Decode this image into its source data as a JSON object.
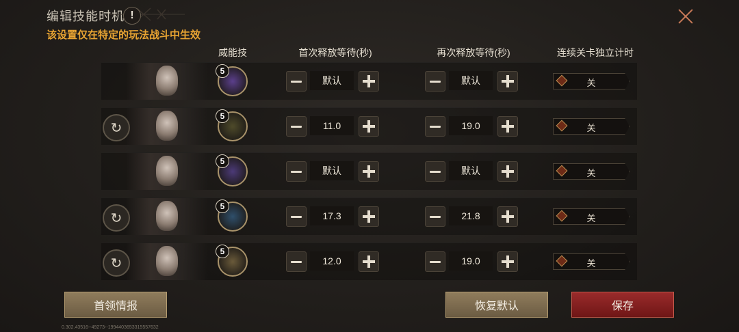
{
  "header": {
    "title": "编辑技能时机",
    "info_icon": "!",
    "subtitle": "该设置仅在特定的玩法战斗中生效"
  },
  "columns": {
    "skill": "威能技",
    "first_wait": "首次释放等待(秒)",
    "next_wait": "再次释放等待(秒)",
    "independent": "连续关卡独立计时"
  },
  "rows": [
    {
      "has_refresh": false,
      "skill_level": "5",
      "skill_color": "#5b3f8c",
      "first": "默认",
      "next": "默认",
      "toggle": "关"
    },
    {
      "has_refresh": true,
      "skill_level": "5",
      "skill_color": "#4e4a2a",
      "first": "11.0",
      "next": "19.0",
      "toggle": "关"
    },
    {
      "has_refresh": false,
      "skill_level": "5",
      "skill_color": "#4c3a78",
      "first": "默认",
      "next": "默认",
      "toggle": "关"
    },
    {
      "has_refresh": true,
      "skill_level": "5",
      "skill_color": "#2f4f6b",
      "first": "17.3",
      "next": "21.8",
      "toggle": "关"
    },
    {
      "has_refresh": true,
      "skill_level": "5",
      "skill_color": "#6a5a3a",
      "first": "12.0",
      "next": "19.0",
      "toggle": "关"
    }
  ],
  "buttons": {
    "boss_info": "首领情报",
    "restore_default": "恢复默认",
    "save": "保存"
  },
  "version": "0.302.43516--49273--1994403653315557632",
  "colors": {
    "accent": "#e8a432",
    "save": "#9a2b2b",
    "gold_button": "#8f7c5c"
  }
}
